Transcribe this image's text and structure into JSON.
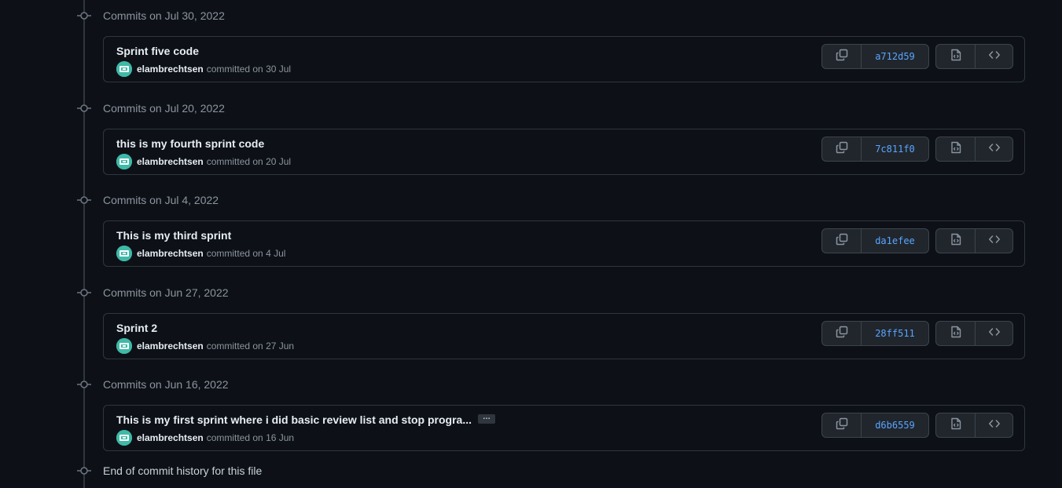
{
  "timeline": {
    "groups": [
      {
        "header": "Commits on Jul 30, 2022",
        "commit": {
          "title": "Sprint five code",
          "truncated": false,
          "author": "elambrechtsen",
          "committed": "committed on 30 Jul",
          "sha": "a712d59"
        }
      },
      {
        "header": "Commits on Jul 20, 2022",
        "commit": {
          "title": "this is my fourth sprint code",
          "truncated": false,
          "author": "elambrechtsen",
          "committed": "committed on 20 Jul",
          "sha": "7c811f0"
        }
      },
      {
        "header": "Commits on Jul 4, 2022",
        "commit": {
          "title": "This is my third sprint",
          "truncated": false,
          "author": "elambrechtsen",
          "committed": "committed on 4 Jul",
          "sha": "da1efee"
        }
      },
      {
        "header": "Commits on Jun 27, 2022",
        "commit": {
          "title": "Sprint 2",
          "truncated": false,
          "author": "elambrechtsen",
          "committed": "committed on 27 Jun",
          "sha": "28ff511"
        }
      },
      {
        "header": "Commits on Jun 16, 2022",
        "commit": {
          "title": "This is my first sprint where i did basic review list and stop progra...",
          "truncated": true,
          "ellipsis_label": "…",
          "author": "elambrechtsen",
          "committed": "committed on 16 Jun",
          "sha": "d6b6559"
        }
      }
    ],
    "end_label": "End of commit history for this file"
  },
  "icons": {
    "node": "git-commit-icon",
    "copy": "copy-icon",
    "view_file": "file-code-icon",
    "browse": "code-icon"
  },
  "colors": {
    "background": "#0d1117",
    "border": "#30363d",
    "sha_link": "#58a6ff",
    "avatar": "#3fb9a8"
  }
}
